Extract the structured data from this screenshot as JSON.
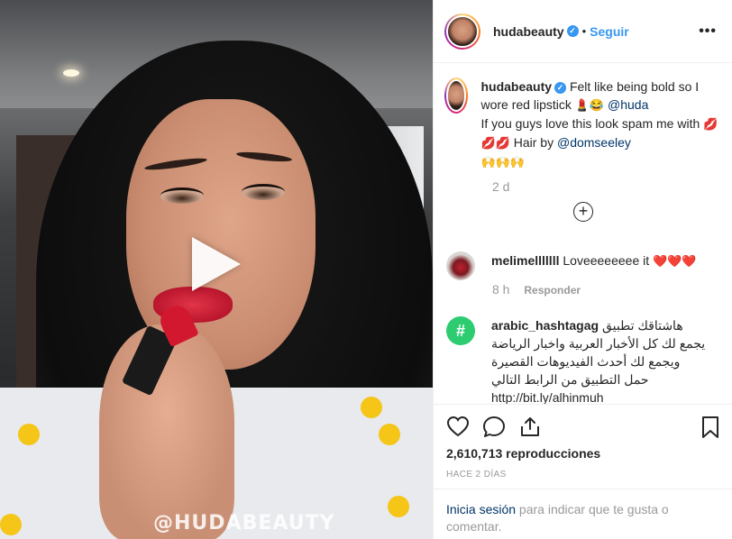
{
  "video": {
    "watermark": "@HUDABEAUTY"
  },
  "header": {
    "username": "hudabeauty",
    "separator": "•",
    "follow_label": "Seguir",
    "more_label": "•••"
  },
  "caption": {
    "username": "hudabeauty",
    "line1": "Felt like being bold so I wore red lipstick ",
    "emoji1": "💄😂",
    "mention1": "@huda",
    "line2": "If you guys love this look spam me with ",
    "emoji2": "💋💋💋",
    "line2b": " Hair by ",
    "mention2": "@domseeley",
    "emoji3": "🙌🙌🙌",
    "age": "2 d"
  },
  "load_more_label": "+",
  "comments": [
    {
      "username": "melimelllllll",
      "text": "Loveeeeeeee it ",
      "emoji": "❤️❤️❤️",
      "age": "8 h",
      "reply_label": "Responder"
    },
    {
      "username": "arabic_hashtagag",
      "text_line1": "هاشتاقك تطبيق",
      "text_line2": "يجمع لك كل الأخبار العربية واخبار الرياضة",
      "text_line3": "ويجمع لك أحدث الفيديوهات القصيرة",
      "text_line4": "حمل التطبيق من الرابط التالي",
      "link": "http://bit.ly/alhinmuh",
      "avatar_glyph": "#"
    }
  ],
  "stats": {
    "views": "2,610,713 reproducciones",
    "posted": "HACE 2 DÍAS"
  },
  "login": {
    "link_label": "Inicia sesión",
    "rest": " para indicar que te gusta o comentar."
  },
  "colors": {
    "accent": "#3897f0",
    "link": "#003569",
    "muted": "#999999"
  }
}
